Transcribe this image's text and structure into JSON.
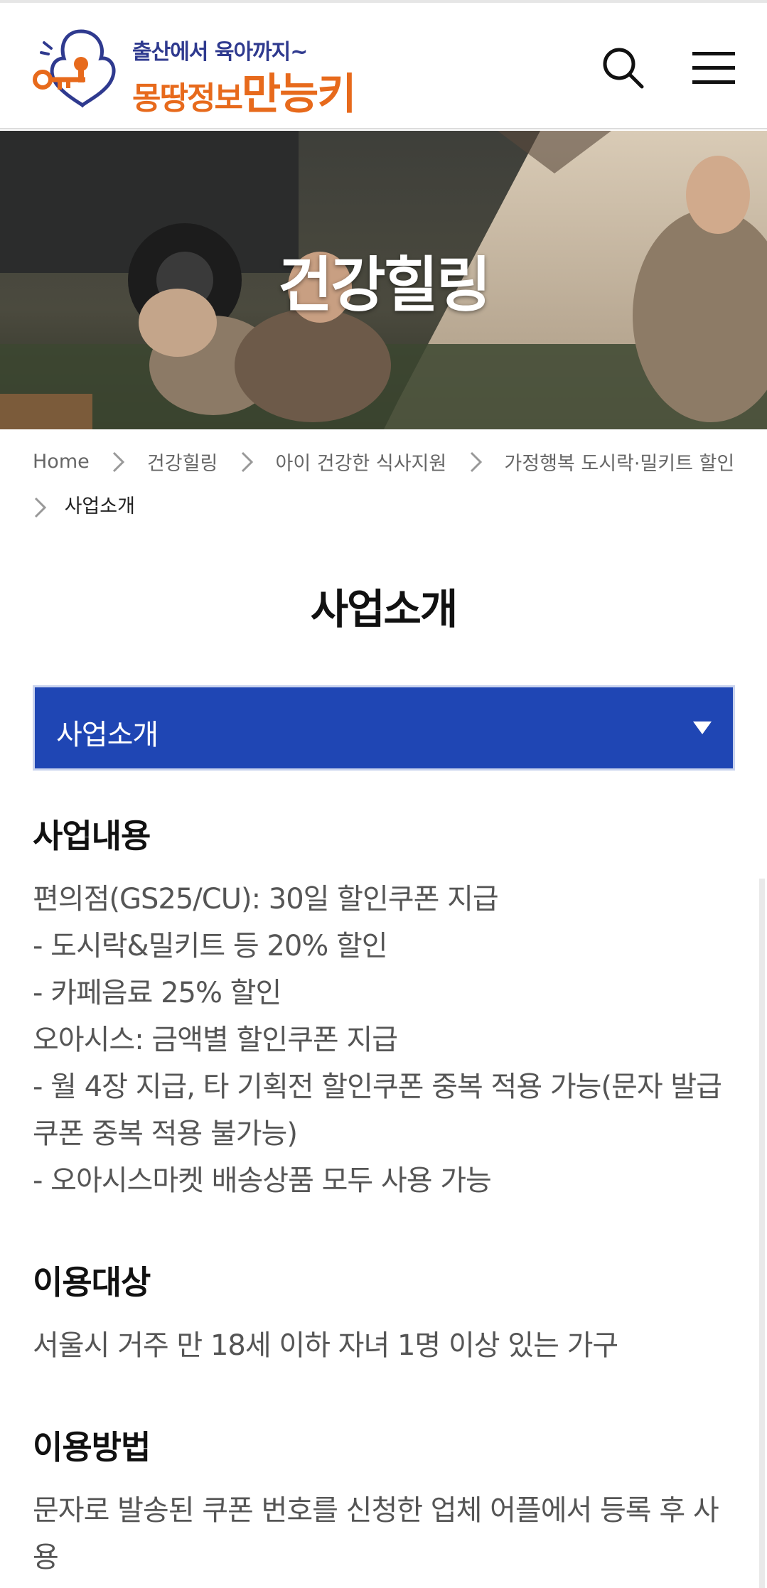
{
  "logo": {
    "tagline": "출산에서 육아까지~",
    "name_part1": "몽땅정보",
    "name_part2": "만능키"
  },
  "colors": {
    "brand_blue": "#2f3a8f",
    "brand_orange": "#e76a1c",
    "select_blue": "#1f46b4"
  },
  "header": {
    "search_icon": "search-icon",
    "menu_icon": "hamburger-menu-icon"
  },
  "hero": {
    "title": "건강힐링"
  },
  "breadcrumb": {
    "items": [
      "Home",
      "건강힐링",
      "아이 건강한 식사지원",
      "가정행복 도시락·밀키트 할인",
      "사업소개"
    ]
  },
  "page": {
    "title": "사업소개"
  },
  "select": {
    "value": "사업소개"
  },
  "sections": [
    {
      "heading": "사업내용",
      "lines": [
        "편의점(GS25/CU): 30일 할인쿠폰 지급",
        "- 도시락&밀키트 등 20% 할인",
        "- 카페음료 25% 할인",
        "오아시스: 금액별 할인쿠폰 지급",
        "- 월 4장 지급, 타 기획전 할인쿠폰 중복 적용 가능(문자 발급 쿠폰 중복 적용 불가능)",
        "- 오아시스마켓 배송상품 모두 사용 가능"
      ]
    },
    {
      "heading": "이용대상",
      "lines": [
        "서울시 거주 만 18세 이하 자녀 1명 이상 있는 가구"
      ]
    },
    {
      "heading": "이용방법",
      "lines": [
        "문자로 발송된 쿠폰 번호를 신청한 업체 어플에서 등록 후 사용"
      ]
    }
  ]
}
